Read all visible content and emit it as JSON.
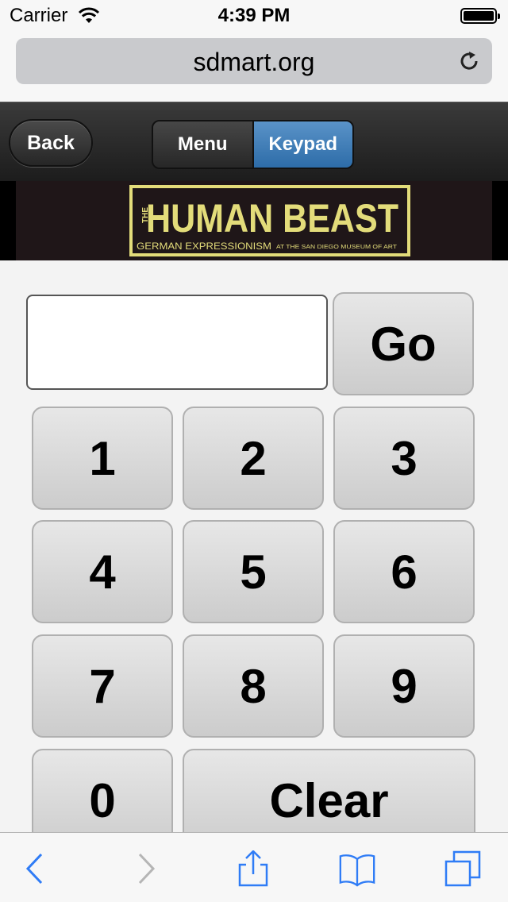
{
  "status_bar": {
    "carrier": "Carrier",
    "time": "4:39 PM"
  },
  "browser": {
    "url": "sdmart.org"
  },
  "toolbar": {
    "back_label": "Back",
    "tabs": [
      {
        "label": "Menu",
        "selected": false
      },
      {
        "label": "Keypad",
        "selected": true
      }
    ],
    "selected_color": "#3a77b3"
  },
  "banner": {
    "logo_text_main": "THE HUMAN BEAST",
    "logo_text_sub": "GERMAN EXPRESSIONISM AT THE SAN DIEGO MUSEUM OF ART",
    "logo_color": "#e3dc7a"
  },
  "keypad": {
    "input_value": "",
    "go_label": "Go",
    "keys": [
      "1",
      "2",
      "3",
      "4",
      "5",
      "6",
      "7",
      "8",
      "9",
      "0"
    ],
    "clear_label": "Clear"
  },
  "bottom_bar": {
    "icons": [
      "back-arrow-icon",
      "forward-arrow-icon",
      "share-icon",
      "bookmarks-icon",
      "tabs-icon"
    ],
    "tint": "#2f7cf6"
  }
}
